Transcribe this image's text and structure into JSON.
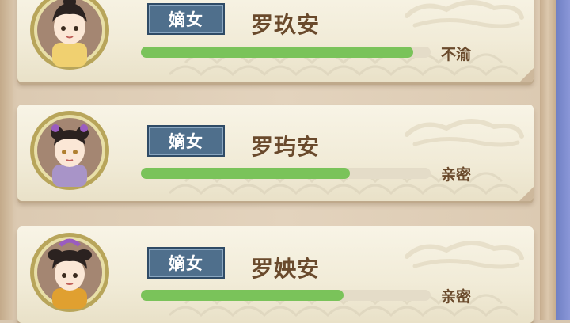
{
  "cards": [
    {
      "tag": "嫡女",
      "name": "罗玖安",
      "status": "不渝",
      "affection": 0.94
    },
    {
      "tag": "嫡女",
      "name": "罗玙安",
      "status": "亲密",
      "affection": 0.72
    },
    {
      "tag": "嫡女",
      "name": "罗姎安",
      "status": "亲密",
      "affection": 0.7
    }
  ],
  "colors": {
    "bar_fill": "#7ac35a",
    "tag_bg": "#4f6f8c",
    "name_text": "#6a4a2c"
  }
}
